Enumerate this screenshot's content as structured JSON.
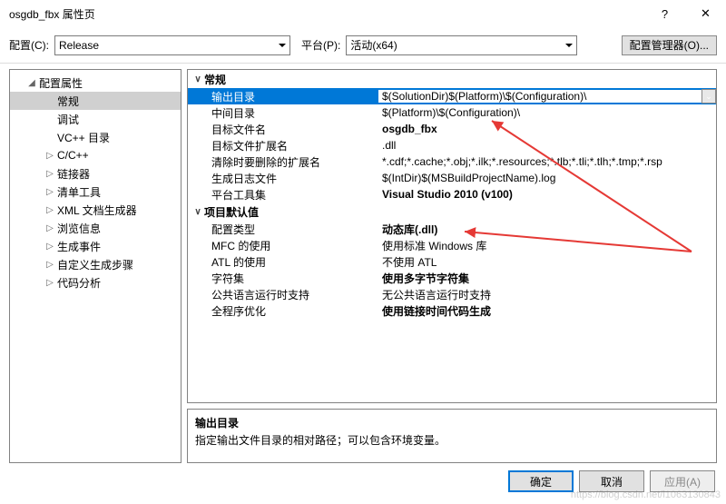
{
  "window": {
    "title": "osgdb_fbx 属性页",
    "help_icon": "?",
    "close_icon": "✕"
  },
  "toolbar": {
    "config_label": "配置(C):",
    "config_value": "Release",
    "platform_label": "平台(P):",
    "platform_value": "活动(x64)",
    "cfgmgr_label": "配置管理器(O)..."
  },
  "tree": {
    "root": "配置属性",
    "items": [
      {
        "label": "常规",
        "selected": true
      },
      {
        "label": "调试"
      },
      {
        "label": "VC++ 目录"
      },
      {
        "label": "C/C++",
        "expandable": true
      },
      {
        "label": "链接器",
        "expandable": true
      },
      {
        "label": "清单工具",
        "expandable": true
      },
      {
        "label": "XML 文档生成器",
        "expandable": true
      },
      {
        "label": "浏览信息",
        "expandable": true
      },
      {
        "label": "生成事件",
        "expandable": true
      },
      {
        "label": "自定义生成步骤",
        "expandable": true
      },
      {
        "label": "代码分析",
        "expandable": true
      }
    ]
  },
  "grid": {
    "cat1": "常规",
    "rows1": [
      {
        "k": "输出目录",
        "v": "$(SolutionDir)$(Platform)\\$(Configuration)\\",
        "selected": true,
        "dd": true
      },
      {
        "k": "中间目录",
        "v": "$(Platform)\\$(Configuration)\\"
      },
      {
        "k": "目标文件名",
        "v": "osgdb_fbx",
        "bold": true
      },
      {
        "k": "目标文件扩展名",
        "v": ".dll"
      },
      {
        "k": "清除时要删除的扩展名",
        "v": "*.cdf;*.cache;*.obj;*.ilk;*.resources;*.tlb;*.tli;*.tlh;*.tmp;*.rsp"
      },
      {
        "k": "生成日志文件",
        "v": "$(IntDir)$(MSBuildProjectName).log"
      },
      {
        "k": "平台工具集",
        "v": "Visual Studio 2010 (v100)",
        "bold": true
      }
    ],
    "cat2": "项目默认值",
    "rows2": [
      {
        "k": "配置类型",
        "v": "动态库(.dll)",
        "bold": true
      },
      {
        "k": "MFC 的使用",
        "v": "使用标准 Windows 库"
      },
      {
        "k": "ATL 的使用",
        "v": "不使用 ATL"
      },
      {
        "k": "字符集",
        "v": "使用多字节字符集",
        "bold": true
      },
      {
        "k": "公共语言运行时支持",
        "v": "无公共语言运行时支持"
      },
      {
        "k": "全程序优化",
        "v": "使用链接时间代码生成",
        "bold": true
      }
    ]
  },
  "desc": {
    "title": "输出目录",
    "text": "指定输出文件目录的相对路径；可以包含环境变量。"
  },
  "footer": {
    "ok": "确定",
    "cancel": "取消",
    "apply": "应用(A)"
  },
  "watermark": "https://blog.csdn.net/l1063130843"
}
